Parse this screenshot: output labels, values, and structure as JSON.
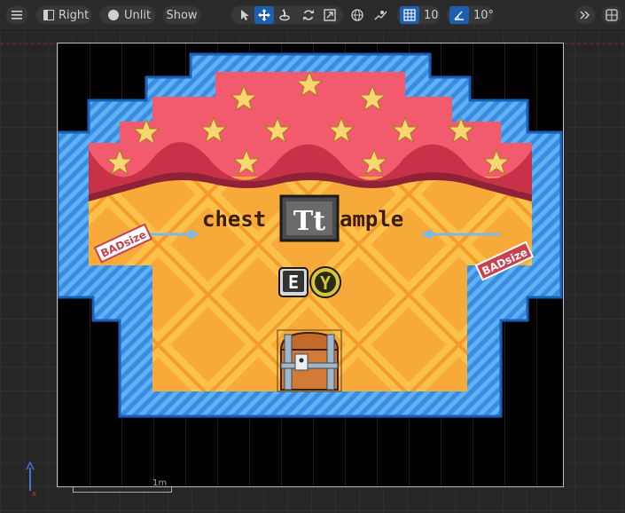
{
  "toolbar": {
    "view_label": "Right",
    "lit_label": "Unlit",
    "show_label": "Show",
    "grid_snap_value": "10",
    "rotation_snap_value": "10°",
    "accent_color": "#1d5fb0"
  },
  "scene": {
    "title_left": "chest",
    "title_right": "ample",
    "left_sign": "BADsize",
    "right_sign": "BADsize",
    "key_e": "E",
    "key_y": "Y",
    "text_icon": "Tt"
  },
  "scale": {
    "label": "1m"
  },
  "icons": [
    "menu-icon",
    "perspective-icon",
    "lit-icon",
    "select-icon",
    "translate-icon",
    "rotate-icon",
    "refresh-icon",
    "scale-icon",
    "globe-icon",
    "surface-snap-icon",
    "grid-snap-icon",
    "angle-snap-icon",
    "overflow-icon",
    "layout-icon"
  ]
}
